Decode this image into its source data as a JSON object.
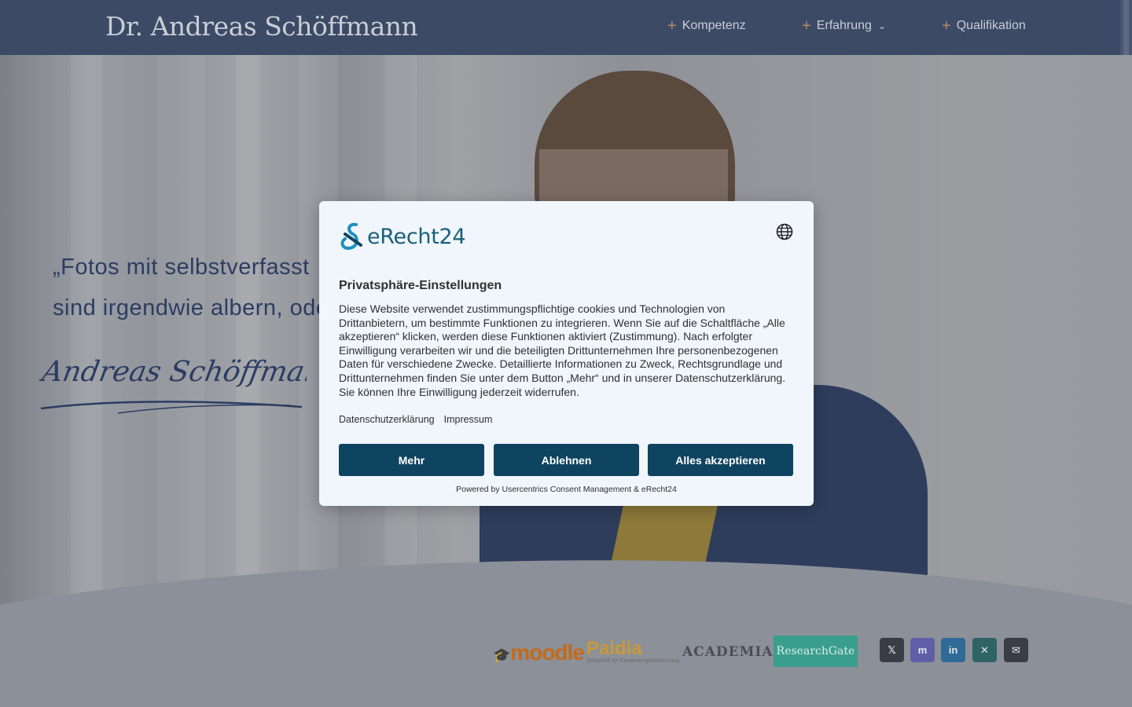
{
  "header": {
    "logo": "Dr. Andreas Schöffmann",
    "nav": [
      {
        "label": "Kompetenz",
        "has_dropdown": false
      },
      {
        "label": "Erfahrung",
        "has_dropdown": true
      },
      {
        "label": "Qualifikation",
        "has_dropdown": false
      }
    ]
  },
  "hero": {
    "quote_line1": "„Fotos mit selbstverfasst",
    "quote_line2": "sind irgendwie albern, ode",
    "signature": "Andreas Schöffmann"
  },
  "partners": {
    "moodle": "moodle",
    "paidia": "Paidia",
    "paidia_sub": "Zeitschrift für Computerspielforschung",
    "academia": "ACADEMIA",
    "researchgate": "ResearchGate"
  },
  "social": [
    {
      "icon": "x-icon",
      "glyph": "𝕏",
      "color": "#3a3d45"
    },
    {
      "icon": "mastodon-icon",
      "glyph": "m",
      "color": "#5f5fa8"
    },
    {
      "icon": "linkedin-icon",
      "glyph": "in",
      "color": "#2f6b96"
    },
    {
      "icon": "xing-icon",
      "glyph": "✕",
      "color": "#2f6464"
    },
    {
      "icon": "mail-icon",
      "glyph": "✉",
      "color": "#3a3d45"
    }
  ],
  "consent": {
    "brand": "eRecht24",
    "title": "Privatsphäre-Einstellungen",
    "body": "Diese Website verwendet zustimmungspflichtige cookies und Technologien von Drittanbietern, um bestimmte Funktionen zu integrieren. Wenn Sie auf die Schaltfläche „Alle akzeptieren“ klicken, werden diese Funktionen aktiviert (Zustimmung). Nach erfolgter Einwilligung verarbeiten wir und die beteiligten Drittunternehmen Ihre personenbezogenen Daten für verschiedene Zwecke. Detaillierte Informationen zu Zweck, Rechtsgrundlage und Drittunternehmen finden Sie unter dem Button „Mehr“ und in unserer Datenschutzerklärung. Sie können Ihre Einwilligung jederzeit widerrufen.",
    "link_privacy": "Datenschutzerklärung",
    "link_imprint": "Impressum",
    "btn_more": "Mehr",
    "btn_decline": "Ablehnen",
    "btn_accept": "Alles akzeptieren",
    "powered": "Powered by Usercentrics Consent Management & eRecht24",
    "accent": "#0e4460"
  }
}
